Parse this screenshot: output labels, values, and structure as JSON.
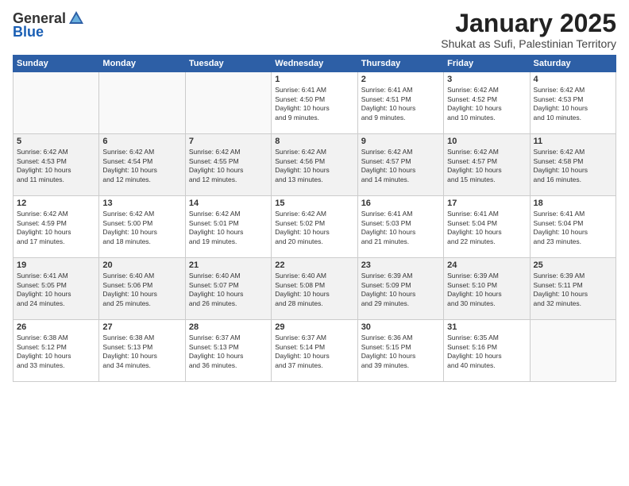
{
  "logo": {
    "general": "General",
    "blue": "Blue"
  },
  "header": {
    "title": "January 2025",
    "subtitle": "Shukat as Sufi, Palestinian Territory"
  },
  "weekdays": [
    "Sunday",
    "Monday",
    "Tuesday",
    "Wednesday",
    "Thursday",
    "Friday",
    "Saturday"
  ],
  "weeks": [
    [
      {
        "day": "",
        "info": ""
      },
      {
        "day": "",
        "info": ""
      },
      {
        "day": "",
        "info": ""
      },
      {
        "day": "1",
        "info": "Sunrise: 6:41 AM\nSunset: 4:50 PM\nDaylight: 10 hours\nand 9 minutes."
      },
      {
        "day": "2",
        "info": "Sunrise: 6:41 AM\nSunset: 4:51 PM\nDaylight: 10 hours\nand 9 minutes."
      },
      {
        "day": "3",
        "info": "Sunrise: 6:42 AM\nSunset: 4:52 PM\nDaylight: 10 hours\nand 10 minutes."
      },
      {
        "day": "4",
        "info": "Sunrise: 6:42 AM\nSunset: 4:53 PM\nDaylight: 10 hours\nand 10 minutes."
      }
    ],
    [
      {
        "day": "5",
        "info": "Sunrise: 6:42 AM\nSunset: 4:53 PM\nDaylight: 10 hours\nand 11 minutes."
      },
      {
        "day": "6",
        "info": "Sunrise: 6:42 AM\nSunset: 4:54 PM\nDaylight: 10 hours\nand 12 minutes."
      },
      {
        "day": "7",
        "info": "Sunrise: 6:42 AM\nSunset: 4:55 PM\nDaylight: 10 hours\nand 12 minutes."
      },
      {
        "day": "8",
        "info": "Sunrise: 6:42 AM\nSunset: 4:56 PM\nDaylight: 10 hours\nand 13 minutes."
      },
      {
        "day": "9",
        "info": "Sunrise: 6:42 AM\nSunset: 4:57 PM\nDaylight: 10 hours\nand 14 minutes."
      },
      {
        "day": "10",
        "info": "Sunrise: 6:42 AM\nSunset: 4:57 PM\nDaylight: 10 hours\nand 15 minutes."
      },
      {
        "day": "11",
        "info": "Sunrise: 6:42 AM\nSunset: 4:58 PM\nDaylight: 10 hours\nand 16 minutes."
      }
    ],
    [
      {
        "day": "12",
        "info": "Sunrise: 6:42 AM\nSunset: 4:59 PM\nDaylight: 10 hours\nand 17 minutes."
      },
      {
        "day": "13",
        "info": "Sunrise: 6:42 AM\nSunset: 5:00 PM\nDaylight: 10 hours\nand 18 minutes."
      },
      {
        "day": "14",
        "info": "Sunrise: 6:42 AM\nSunset: 5:01 PM\nDaylight: 10 hours\nand 19 minutes."
      },
      {
        "day": "15",
        "info": "Sunrise: 6:42 AM\nSunset: 5:02 PM\nDaylight: 10 hours\nand 20 minutes."
      },
      {
        "day": "16",
        "info": "Sunrise: 6:41 AM\nSunset: 5:03 PM\nDaylight: 10 hours\nand 21 minutes."
      },
      {
        "day": "17",
        "info": "Sunrise: 6:41 AM\nSunset: 5:04 PM\nDaylight: 10 hours\nand 22 minutes."
      },
      {
        "day": "18",
        "info": "Sunrise: 6:41 AM\nSunset: 5:04 PM\nDaylight: 10 hours\nand 23 minutes."
      }
    ],
    [
      {
        "day": "19",
        "info": "Sunrise: 6:41 AM\nSunset: 5:05 PM\nDaylight: 10 hours\nand 24 minutes."
      },
      {
        "day": "20",
        "info": "Sunrise: 6:40 AM\nSunset: 5:06 PM\nDaylight: 10 hours\nand 25 minutes."
      },
      {
        "day": "21",
        "info": "Sunrise: 6:40 AM\nSunset: 5:07 PM\nDaylight: 10 hours\nand 26 minutes."
      },
      {
        "day": "22",
        "info": "Sunrise: 6:40 AM\nSunset: 5:08 PM\nDaylight: 10 hours\nand 28 minutes."
      },
      {
        "day": "23",
        "info": "Sunrise: 6:39 AM\nSunset: 5:09 PM\nDaylight: 10 hours\nand 29 minutes."
      },
      {
        "day": "24",
        "info": "Sunrise: 6:39 AM\nSunset: 5:10 PM\nDaylight: 10 hours\nand 30 minutes."
      },
      {
        "day": "25",
        "info": "Sunrise: 6:39 AM\nSunset: 5:11 PM\nDaylight: 10 hours\nand 32 minutes."
      }
    ],
    [
      {
        "day": "26",
        "info": "Sunrise: 6:38 AM\nSunset: 5:12 PM\nDaylight: 10 hours\nand 33 minutes."
      },
      {
        "day": "27",
        "info": "Sunrise: 6:38 AM\nSunset: 5:13 PM\nDaylight: 10 hours\nand 34 minutes."
      },
      {
        "day": "28",
        "info": "Sunrise: 6:37 AM\nSunset: 5:13 PM\nDaylight: 10 hours\nand 36 minutes."
      },
      {
        "day": "29",
        "info": "Sunrise: 6:37 AM\nSunset: 5:14 PM\nDaylight: 10 hours\nand 37 minutes."
      },
      {
        "day": "30",
        "info": "Sunrise: 6:36 AM\nSunset: 5:15 PM\nDaylight: 10 hours\nand 39 minutes."
      },
      {
        "day": "31",
        "info": "Sunrise: 6:35 AM\nSunset: 5:16 PM\nDaylight: 10 hours\nand 40 minutes."
      },
      {
        "day": "",
        "info": ""
      }
    ]
  ]
}
